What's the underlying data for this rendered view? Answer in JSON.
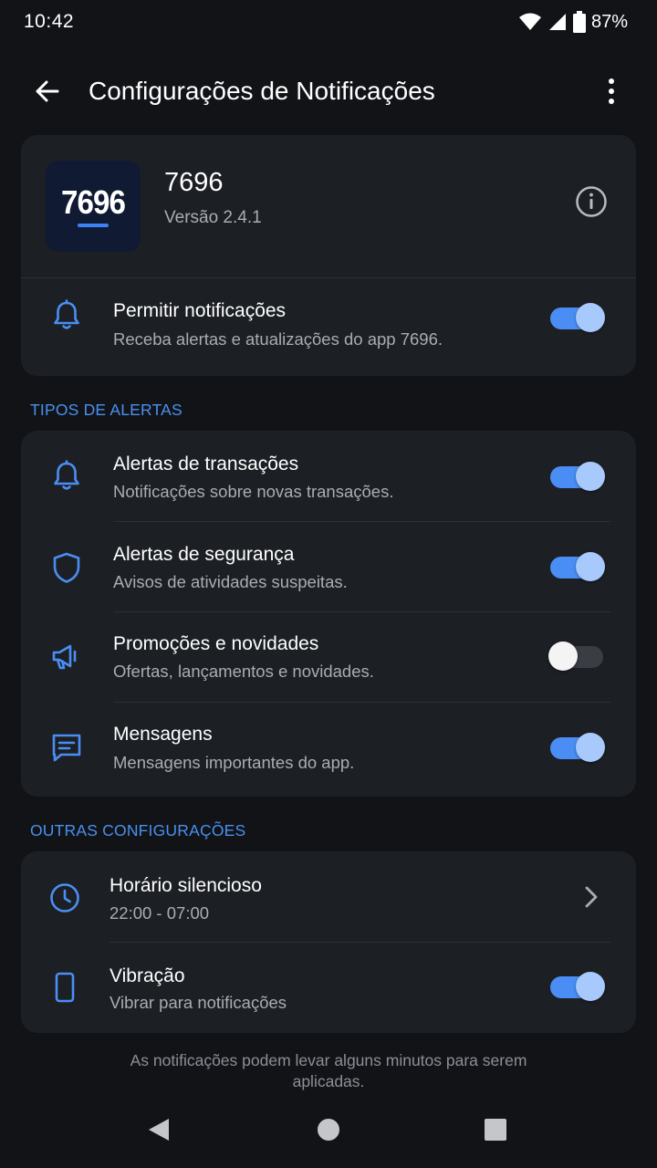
{
  "status_bar": {
    "time": "10:42",
    "battery": "87%",
    "icons": [
      "wifi-icon",
      "signal-icon",
      "battery-icon"
    ]
  },
  "app_bar": {
    "title": "Configurações de Notificações",
    "back_icon": "arrow-left-icon",
    "menu_icon": "more-vert-icon"
  },
  "app_info": {
    "logo_text": "7696",
    "name": "7696",
    "version": "Versão 2.4.1",
    "info_icon": "info-icon",
    "allow": {
      "title": "Permitir notificações",
      "subtitle": "Receba alertas e atualizações do app 7696.",
      "icon": "bell-icon",
      "enabled": true
    }
  },
  "alert_types": {
    "section_label": "TIPOS DE ALERTAS",
    "items": [
      {
        "title": "Alertas de transações",
        "subtitle": "Notificações sobre novas transações.",
        "icon": "bell-icon",
        "enabled": true
      },
      {
        "title": "Alertas de segurança",
        "subtitle": "Avisos de atividades suspeitas.",
        "icon": "shield-icon",
        "enabled": true
      },
      {
        "title": "Promoções e novidades",
        "subtitle": "Ofertas, lançamentos e novidades.",
        "icon": "megaphone-icon",
        "enabled": false
      },
      {
        "title": "Mensagens",
        "subtitle": "Mensagens importantes do app.",
        "icon": "message-icon",
        "enabled": true
      }
    ]
  },
  "other_settings": {
    "section_label": "OUTRAS CONFIGURAÇÕES",
    "quiet_hours": {
      "title": "Horário silencioso",
      "value": "22:00 - 07:00",
      "icon": "clock-icon"
    },
    "vibration": {
      "title": "Vibração",
      "subtitle": "Vibrar para notificações",
      "icon": "phone-icon",
      "enabled": true
    }
  },
  "footer_note": "As notificações podem levar alguns minutos para serem aplicadas.",
  "colors": {
    "background": "#111317",
    "card": "#1c1f24",
    "accent": "#4a8ef5",
    "section_label": "#4a90ee",
    "secondary_text": "#a9adb4"
  }
}
